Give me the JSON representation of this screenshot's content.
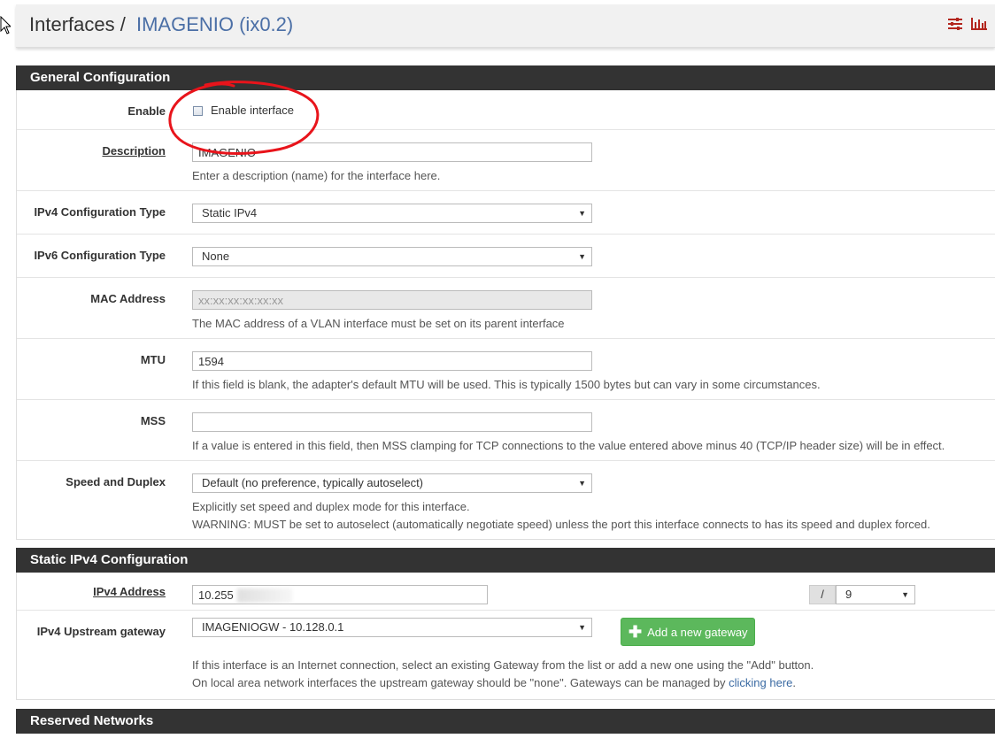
{
  "breadcrumb": {
    "section": "Interfaces",
    "separator": "/",
    "current": "IMAGENIO (ix0.2)"
  },
  "icons": [
    "sliders-icon",
    "bar-chart-icon"
  ],
  "general": {
    "heading": "General Configuration",
    "enable_label": "Enable",
    "enable_checkbox_label": "Enable interface",
    "enable_checked": false,
    "description_label": "Description",
    "description_value": "IMAGENIO",
    "description_help": "Enter a description (name) for the interface here.",
    "ipv4_type_label": "IPv4 Configuration Type",
    "ipv4_type_value": "Static IPv4",
    "ipv6_type_label": "IPv6 Configuration Type",
    "ipv6_type_value": "None",
    "mac_label": "MAC Address",
    "mac_placeholder": "xx:xx:xx:xx:xx:xx",
    "mac_help": "The MAC address of a VLAN interface must be set on its parent interface",
    "mtu_label": "MTU",
    "mtu_value": "1594",
    "mtu_help": "If this field is blank, the adapter's default MTU will be used. This is typically 1500 bytes but can vary in some circumstances.",
    "mss_label": "MSS",
    "mss_value": "",
    "mss_help": "If a value is entered in this field, then MSS clamping for TCP connections to the value entered above minus 40 (TCP/IP header size) will be in effect.",
    "speed_label": "Speed and Duplex",
    "speed_value": "Default (no preference, typically autoselect)",
    "speed_help1": "Explicitly set speed and duplex mode for this interface.",
    "speed_help2": "WARNING: MUST be set to autoselect (automatically negotiate speed) unless the port this interface connects to has its speed and duplex forced."
  },
  "static_ipv4": {
    "heading": "Static IPv4 Configuration",
    "address_label": "IPv4 Address",
    "address_value": "10.255",
    "slash": "/",
    "cidr_value": "9",
    "gateway_label": "IPv4 Upstream gateway",
    "gateway_value": "IMAGENIOGW - 10.128.0.1",
    "add_gateway_button": "Add a new gateway",
    "gateway_help1": "If this interface is an Internet connection, select an existing Gateway from the list or add a new one using the \"Add\" button.",
    "gateway_help2_prefix": "On local area network interfaces the upstream gateway should be \"none\". Gateways can be managed by ",
    "gateway_help2_link": "clicking here",
    "gateway_help2_suffix": "."
  },
  "reserved": {
    "heading": "Reserved Networks"
  },
  "colors": {
    "panel_heading": "#333333",
    "breadcrumb_active": "#4b6fa6",
    "button_green": "#5cb85c",
    "annotation_red": "#e8141b"
  }
}
